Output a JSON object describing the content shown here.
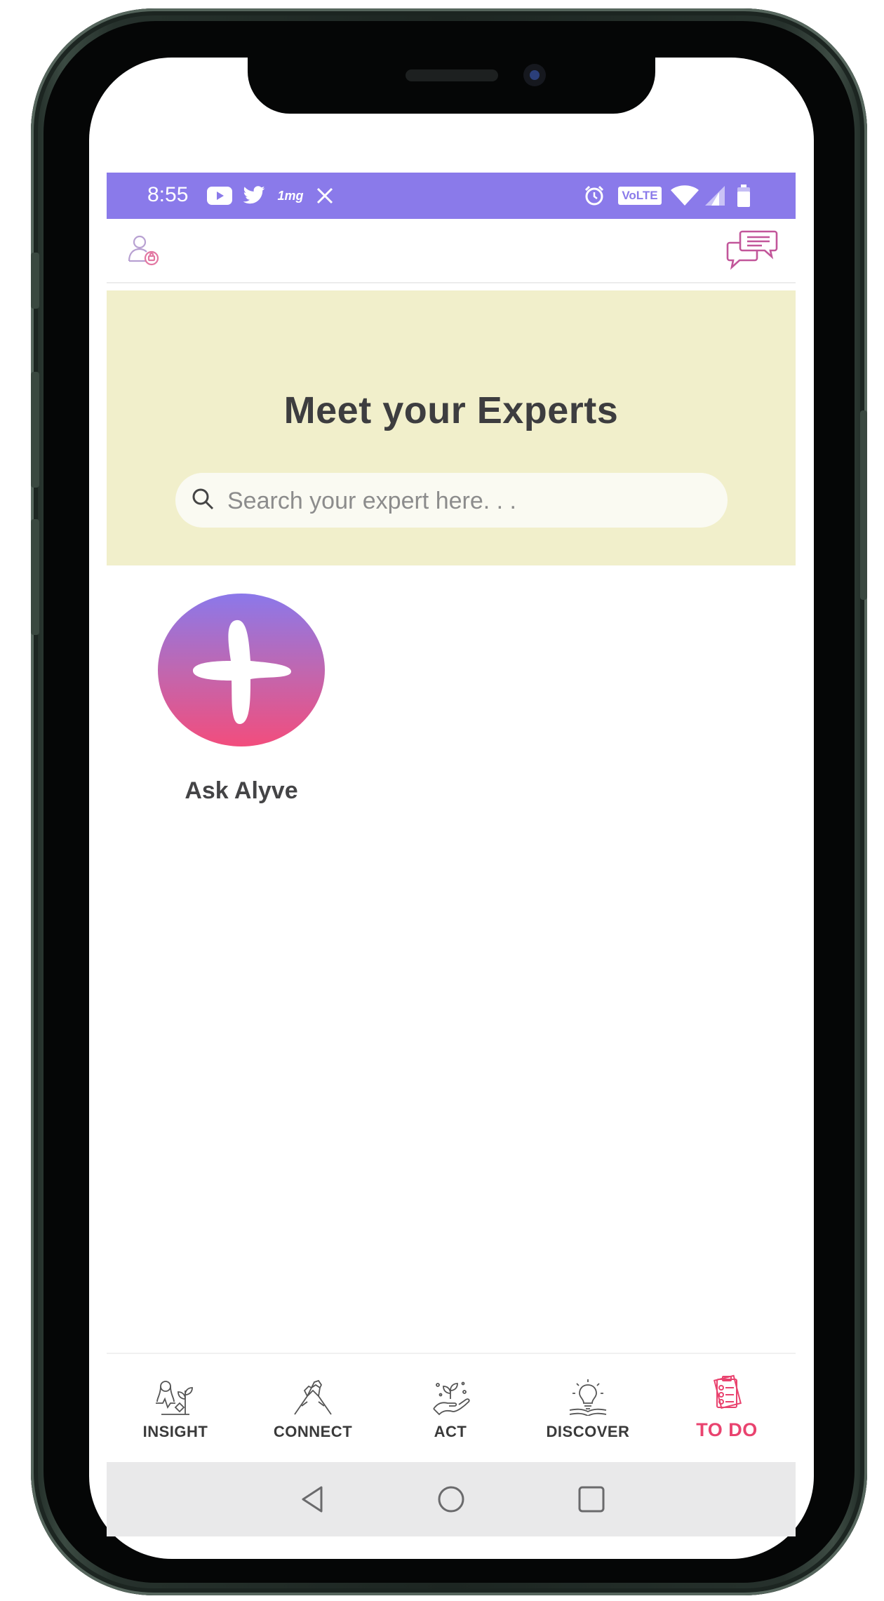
{
  "status_bar": {
    "time": "8:55",
    "left_icons": [
      "youtube-icon",
      "twitter-icon",
      "1mg-icon",
      "x-icon"
    ],
    "onemg_label": "1mg",
    "volte_label": "VoLTE",
    "right_icons": [
      "alarm-icon",
      "volte-icon",
      "wifi-icon",
      "signal-icon",
      "battery-icon"
    ]
  },
  "top_bar": {
    "left_icon": "profile-icon",
    "right_icon": "chat-icon"
  },
  "hero": {
    "title": "Meet your Experts",
    "search_placeholder": "Search your expert here. . ."
  },
  "experts": [
    {
      "name": "Ask Alyve",
      "icon": "alyve-star-icon"
    }
  ],
  "bottom_nav": {
    "items": [
      {
        "label": "INSIGHT",
        "icon": "insight-icon",
        "active": false
      },
      {
        "label": "CONNECT",
        "icon": "connect-icon",
        "active": false
      },
      {
        "label": "ACT",
        "icon": "act-icon",
        "active": false
      },
      {
        "label": "DISCOVER",
        "icon": "discover-icon",
        "active": false
      },
      {
        "label": "TO DO",
        "icon": "todo-icon",
        "active": true
      }
    ]
  },
  "system_nav": {
    "buttons": [
      "back-icon",
      "home-icon",
      "recents-icon"
    ]
  },
  "colors": {
    "status_bar": "#8a7aea",
    "hero_bg": "#f1efcb",
    "accent_pink": "#e9436f",
    "icon_pink": "#c25a9a"
  }
}
